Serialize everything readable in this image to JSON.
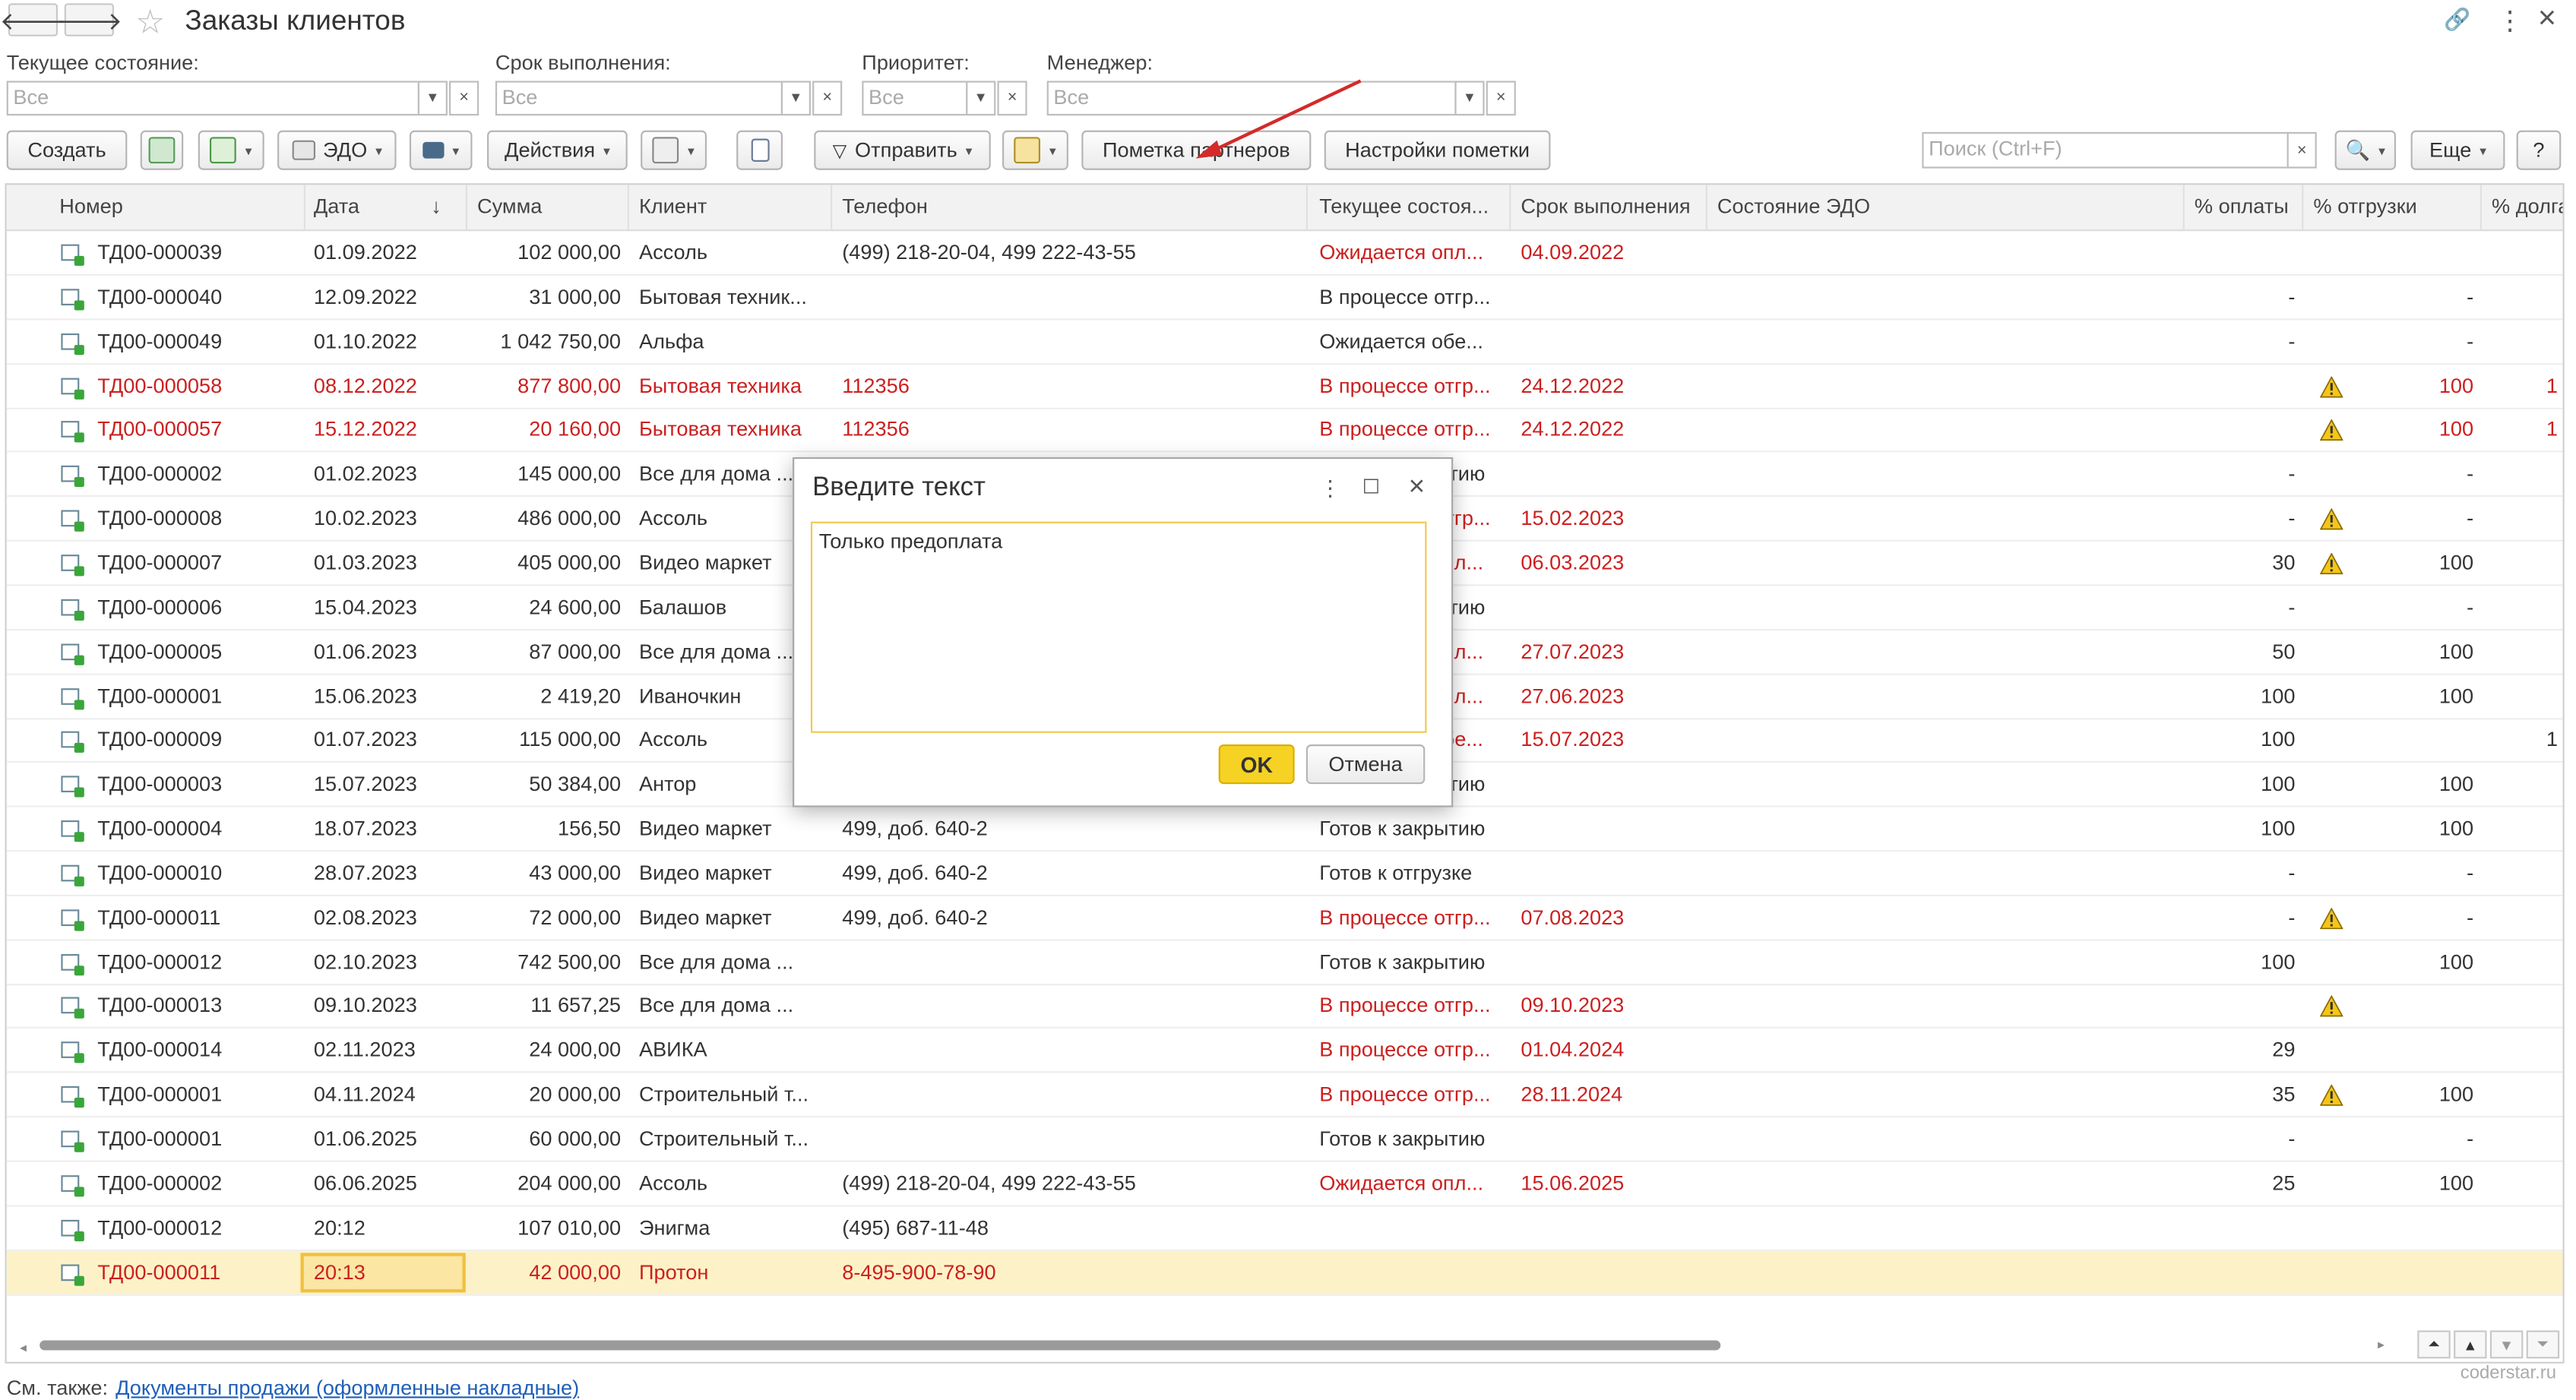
{
  "window": {
    "title": "Заказы клиентов",
    "back_glyph": "🡐",
    "forward_glyph": "🡒",
    "star_glyph": "☆",
    "link_glyph": "🔗",
    "more_glyph": "⋮",
    "close_glyph": "×"
  },
  "filters": {
    "state_label": "Текущее состояние:",
    "state_value": "Все",
    "deadline_label": "Срок выполнения:",
    "deadline_value": "Все",
    "priority_label": "Приоритет:",
    "priority_value": "Все",
    "manager_label": "Менеджер:",
    "manager_value": "Все"
  },
  "toolbar": {
    "create": "Создать",
    "edo": "ЭДО",
    "actions": "Действия",
    "send": "Отправить",
    "partner_mark": "Пометка партнеров",
    "mark_settings": "Настройки пометки",
    "search_placeholder": "Поиск (Ctrl+F)",
    "more": "Еще",
    "help": "?",
    "caret": "▾",
    "clear": "×"
  },
  "table": {
    "columns": [
      "Номер",
      "Дата",
      "Сумма",
      "Клиент",
      "Телефон",
      "Текущее состоя...",
      "Срок выполнения",
      "Состояние ЭДО",
      "% оплаты",
      "% отгрузки",
      "% долга"
    ],
    "sort_glyph": "↓",
    "rows": [
      {
        "num": "ТД00-000039",
        "date": "01.09.2022",
        "sum": "102 000,00",
        "client": "Ассоль",
        "phone": "(499) 218-20-04, 499 222-43-55",
        "state": "Ожидается опл...",
        "deadline": "04.09.2022",
        "pay": "",
        "ship": "",
        "debt": "",
        "red": false,
        "state_red": true,
        "deadline_red": true,
        "warn": false
      },
      {
        "num": "ТД00-000040",
        "date": "12.09.2022",
        "sum": "31 000,00",
        "client": "Бытовая техник...",
        "phone": "",
        "state": "В процессе отгр...",
        "deadline": "",
        "pay": "-",
        "ship": "-",
        "debt": "",
        "red": false,
        "state_red": false,
        "deadline_red": false,
        "warn": false
      },
      {
        "num": "ТД00-000049",
        "date": "01.10.2022",
        "sum": "1 042 750,00",
        "client": "Альфа",
        "phone": "",
        "state": "Ожидается обе...",
        "deadline": "",
        "pay": "-",
        "ship": "-",
        "debt": "",
        "red": false,
        "state_red": false,
        "deadline_red": false,
        "warn": false
      },
      {
        "num": "ТД00-000058",
        "date": "08.12.2022",
        "sum": "877 800,00",
        "client": "Бытовая техника",
        "phone": "112356",
        "state": "В процессе отгр...",
        "deadline": "24.12.2022",
        "pay": "",
        "ship": "100",
        "debt": "1",
        "red": true,
        "state_red": true,
        "deadline_red": true,
        "warn": true
      },
      {
        "num": "ТД00-000057",
        "date": "15.12.2022",
        "sum": "20 160,00",
        "client": "Бытовая техника",
        "phone": "112356",
        "state": "В процессе отгр...",
        "deadline": "24.12.2022",
        "pay": "",
        "ship": "100",
        "debt": "1",
        "red": true,
        "state_red": true,
        "deadline_red": true,
        "warn": true
      },
      {
        "num": "ТД00-000002",
        "date": "01.02.2023",
        "sum": "145 000,00",
        "client": "Все для дома ...",
        "phone": "",
        "state": "Готов к закрытию",
        "deadline": "",
        "pay": "-",
        "ship": "-",
        "debt": "",
        "red": false,
        "state_red": false,
        "deadline_red": false,
        "warn": false
      },
      {
        "num": "ТД00-000008",
        "date": "10.02.2023",
        "sum": "486 000,00",
        "client": "Ассоль",
        "phone": "",
        "state": "В процессе отгр...",
        "deadline": "15.02.2023",
        "pay": "-",
        "ship": "-",
        "debt": "",
        "red": false,
        "state_red": true,
        "deadline_red": true,
        "warn": true
      },
      {
        "num": "ТД00-000007",
        "date": "01.03.2023",
        "sum": "405 000,00",
        "client": "Видео маркет",
        "phone": "",
        "state": "Ожидается опл...",
        "deadline": "06.03.2023",
        "pay": "30",
        "ship": "100",
        "debt": "",
        "red": false,
        "state_red": true,
        "deadline_red": true,
        "warn": true
      },
      {
        "num": "ТД00-000006",
        "date": "15.04.2023",
        "sum": "24 600,00",
        "client": "Балашов",
        "phone": "",
        "state": "Готов к закрытию",
        "deadline": "",
        "pay": "-",
        "ship": "-",
        "debt": "",
        "red": false,
        "state_red": false,
        "deadline_red": false,
        "warn": false
      },
      {
        "num": "ТД00-000005",
        "date": "01.06.2023",
        "sum": "87 000,00",
        "client": "Все для дома ...",
        "phone": "",
        "state": "Ожидается опл...",
        "deadline": "27.07.2023",
        "pay": "50",
        "ship": "100",
        "debt": "",
        "red": false,
        "state_red": true,
        "deadline_red": true,
        "warn": false
      },
      {
        "num": "ТД00-000001",
        "date": "15.06.2023",
        "sum": "2 419,20",
        "client": "Иваночкин",
        "phone": "",
        "state": "Ожидается опл...",
        "deadline": "27.06.2023",
        "pay": "100",
        "ship": "100",
        "debt": "",
        "red": false,
        "state_red": true,
        "deadline_red": true,
        "warn": false
      },
      {
        "num": "ТД00-000009",
        "date": "01.07.2023",
        "sum": "115 000,00",
        "client": "Ассоль",
        "phone": "",
        "state": "Ожидается обе...",
        "deadline": "15.07.2023",
        "pay": "100",
        "ship": "",
        "debt": "1",
        "red": false,
        "state_red": true,
        "deadline_red": true,
        "warn": false
      },
      {
        "num": "ТД00-000003",
        "date": "15.07.2023",
        "sum": "50 384,00",
        "client": "Антор",
        "phone": "",
        "state": "Готов к закрытию",
        "deadline": "",
        "pay": "100",
        "ship": "100",
        "debt": "",
        "red": false,
        "state_red": false,
        "deadline_red": false,
        "warn": false
      },
      {
        "num": "ТД00-000004",
        "date": "18.07.2023",
        "sum": "156,50",
        "client": "Видео маркет",
        "phone": "499, доб. 640-2",
        "state": "Готов к закрытию",
        "deadline": "",
        "pay": "100",
        "ship": "100",
        "debt": "",
        "red": false,
        "state_red": false,
        "deadline_red": false,
        "warn": false
      },
      {
        "num": "ТД00-000010",
        "date": "28.07.2023",
        "sum": "43 000,00",
        "client": "Видео маркет",
        "phone": "499, доб. 640-2",
        "state": "Готов к отгрузке",
        "deadline": "",
        "pay": "-",
        "ship": "-",
        "debt": "",
        "red": false,
        "state_red": false,
        "deadline_red": false,
        "warn": false
      },
      {
        "num": "ТД00-000011",
        "date": "02.08.2023",
        "sum": "72 000,00",
        "client": "Видео маркет",
        "phone": "499, доб. 640-2",
        "state": "В процессе отгр...",
        "deadline": "07.08.2023",
        "pay": "-",
        "ship": "-",
        "debt": "",
        "red": false,
        "state_red": true,
        "deadline_red": true,
        "warn": true
      },
      {
        "num": "ТД00-000012",
        "date": "02.10.2023",
        "sum": "742 500,00",
        "client": "Все для дома ...",
        "phone": "",
        "state": "Готов к закрытию",
        "deadline": "",
        "pay": "100",
        "ship": "100",
        "debt": "",
        "red": false,
        "state_red": false,
        "deadline_red": false,
        "warn": false
      },
      {
        "num": "ТД00-000013",
        "date": "09.10.2023",
        "sum": "11 657,25",
        "client": "Все для дома ...",
        "phone": "",
        "state": "В процессе отгр...",
        "deadline": "09.10.2023",
        "pay": "",
        "ship": "",
        "debt": "",
        "red": false,
        "state_red": true,
        "deadline_red": true,
        "warn": true
      },
      {
        "num": "ТД00-000014",
        "date": "02.11.2023",
        "sum": "24 000,00",
        "client": "АВИКА",
        "phone": "",
        "state": "В процессе отгр...",
        "deadline": "01.04.2024",
        "pay": "29",
        "ship": "",
        "debt": "",
        "red": false,
        "state_red": true,
        "deadline_red": true,
        "warn": false
      },
      {
        "num": "ТД00-000001",
        "date": "04.11.2024",
        "sum": "20 000,00",
        "client": "Строительный т...",
        "phone": "",
        "state": "В процессе отгр...",
        "deadline": "28.11.2024",
        "pay": "35",
        "ship": "100",
        "debt": "",
        "red": false,
        "state_red": true,
        "deadline_red": true,
        "warn": true
      },
      {
        "num": "ТД00-000001",
        "date": "01.06.2025",
        "sum": "60 000,00",
        "client": "Строительный т...",
        "phone": "",
        "state": "Готов к закрытию",
        "deadline": "",
        "pay": "-",
        "ship": "-",
        "debt": "",
        "red": false,
        "state_red": false,
        "deadline_red": false,
        "warn": false
      },
      {
        "num": "ТД00-000002",
        "date": "06.06.2025",
        "sum": "204 000,00",
        "client": "Ассоль",
        "phone": "(499) 218-20-04, 499 222-43-55",
        "state": "Ожидается опл...",
        "deadline": "15.06.2025",
        "pay": "25",
        "ship": "100",
        "debt": "",
        "red": false,
        "state_red": true,
        "deadline_red": true,
        "warn": false
      },
      {
        "num": "ТД00-000012",
        "date": "20:12",
        "sum": "107 010,00",
        "client": "Энигма",
        "phone": "(495) 687-11-48",
        "state": "",
        "deadline": "",
        "pay": "",
        "ship": "",
        "debt": "",
        "red": false,
        "state_red": false,
        "deadline_red": false,
        "warn": false
      },
      {
        "num": "ТД00-000011",
        "date": "20:13",
        "sum": "42 000,00",
        "client": "Протон",
        "phone": "8-495-900-78-90",
        "state": "",
        "deadline": "",
        "pay": "",
        "ship": "",
        "debt": "",
        "red": true,
        "state_red": false,
        "deadline_red": false,
        "warn": false,
        "selected": true
      }
    ]
  },
  "dialog": {
    "title": "Введите текст",
    "text": "Только предоплата",
    "ok": "OK",
    "cancel": "Отмена",
    "menu_glyph": "⋮",
    "max_glyph": "☐",
    "close_glyph": "×"
  },
  "footer": {
    "see_also": "См. также:",
    "link": "Документы продажи (оформленные накладные)",
    "watermark": "coderstar.ru"
  },
  "colors": {
    "red_text": "#cc1f1f",
    "selected_row": "#fdf2c7",
    "ok_yellow": "#f6d224",
    "link_blue": "#1f5fb8",
    "annotation_arrow": "#d42a2a"
  }
}
